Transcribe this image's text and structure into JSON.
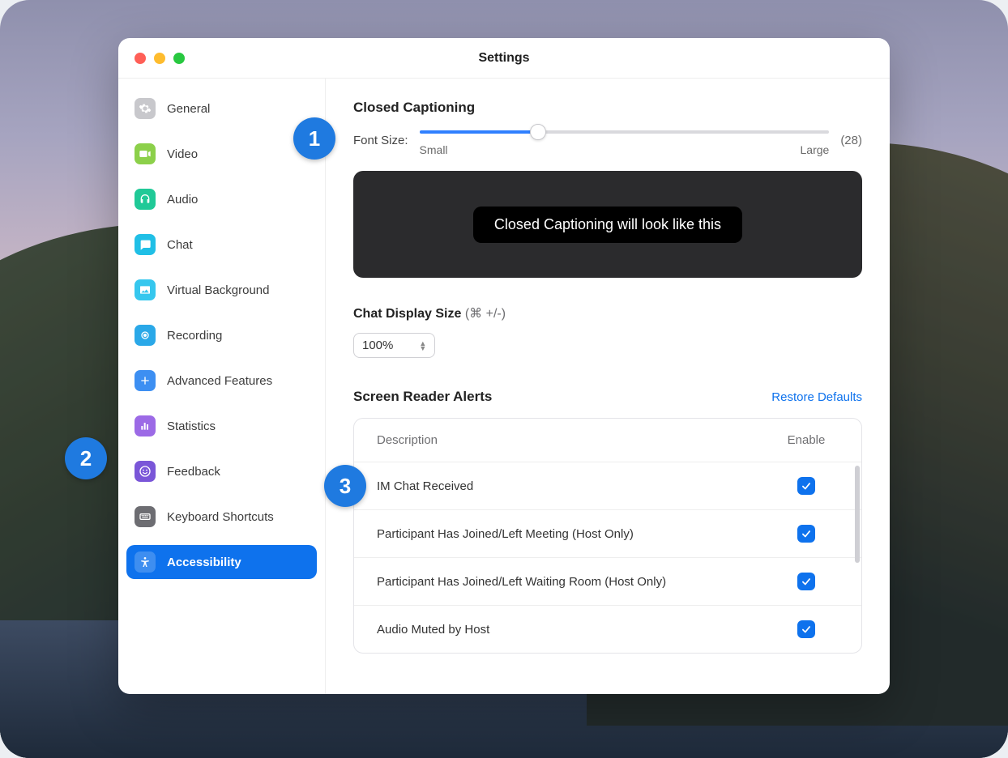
{
  "window": {
    "title": "Settings"
  },
  "sidebar": {
    "items": [
      {
        "label": "General",
        "icon": "gear-icon",
        "color": "#c8c8cc",
        "active": false
      },
      {
        "label": "Video",
        "icon": "video-icon",
        "color": "#8cd04a",
        "active": false
      },
      {
        "label": "Audio",
        "icon": "headphones-icon",
        "color": "#20c997",
        "active": false
      },
      {
        "label": "Chat",
        "icon": "chat-icon",
        "color": "#20bfe6",
        "active": false
      },
      {
        "label": "Virtual Background",
        "icon": "image-icon",
        "color": "#36c7ee",
        "active": false
      },
      {
        "label": "Recording",
        "icon": "record-icon",
        "color": "#2aa8e8",
        "active": false
      },
      {
        "label": "Advanced Features",
        "icon": "plus-icon",
        "color": "#3d8ff2",
        "active": false
      },
      {
        "label": "Statistics",
        "icon": "bars-icon",
        "color": "#9c6ae6",
        "active": false
      },
      {
        "label": "Feedback",
        "icon": "smile-icon",
        "color": "#7a56d8",
        "active": false
      },
      {
        "label": "Keyboard Shortcuts",
        "icon": "keyboard-icon",
        "color": "#6d6d72",
        "active": false
      },
      {
        "label": "Accessibility",
        "icon": "accessibility-icon",
        "color": "#0e72ed",
        "active": true
      }
    ]
  },
  "closed_captioning": {
    "title": "Closed Captioning",
    "font_size_label": "Font Size:",
    "small_label": "Small",
    "large_label": "Large",
    "value_text": "(28)",
    "preview_text": "Closed Captioning will look like this",
    "slider_percent": 29
  },
  "chat_display": {
    "title": "Chat Display Size",
    "hint": "(⌘ +/-)",
    "value": "100%"
  },
  "screen_reader": {
    "title": "Screen Reader Alerts",
    "restore_label": "Restore Defaults",
    "columns": {
      "desc": "Description",
      "enable": "Enable"
    },
    "rows": [
      {
        "desc": "IM Chat Received",
        "enabled": true
      },
      {
        "desc": "Participant Has Joined/Left Meeting (Host Only)",
        "enabled": true
      },
      {
        "desc": "Participant Has Joined/Left Waiting Room (Host Only)",
        "enabled": true
      },
      {
        "desc": "Audio Muted by Host",
        "enabled": true
      }
    ]
  },
  "annotations": {
    "b1": "1",
    "b2": "2",
    "b3": "3"
  }
}
